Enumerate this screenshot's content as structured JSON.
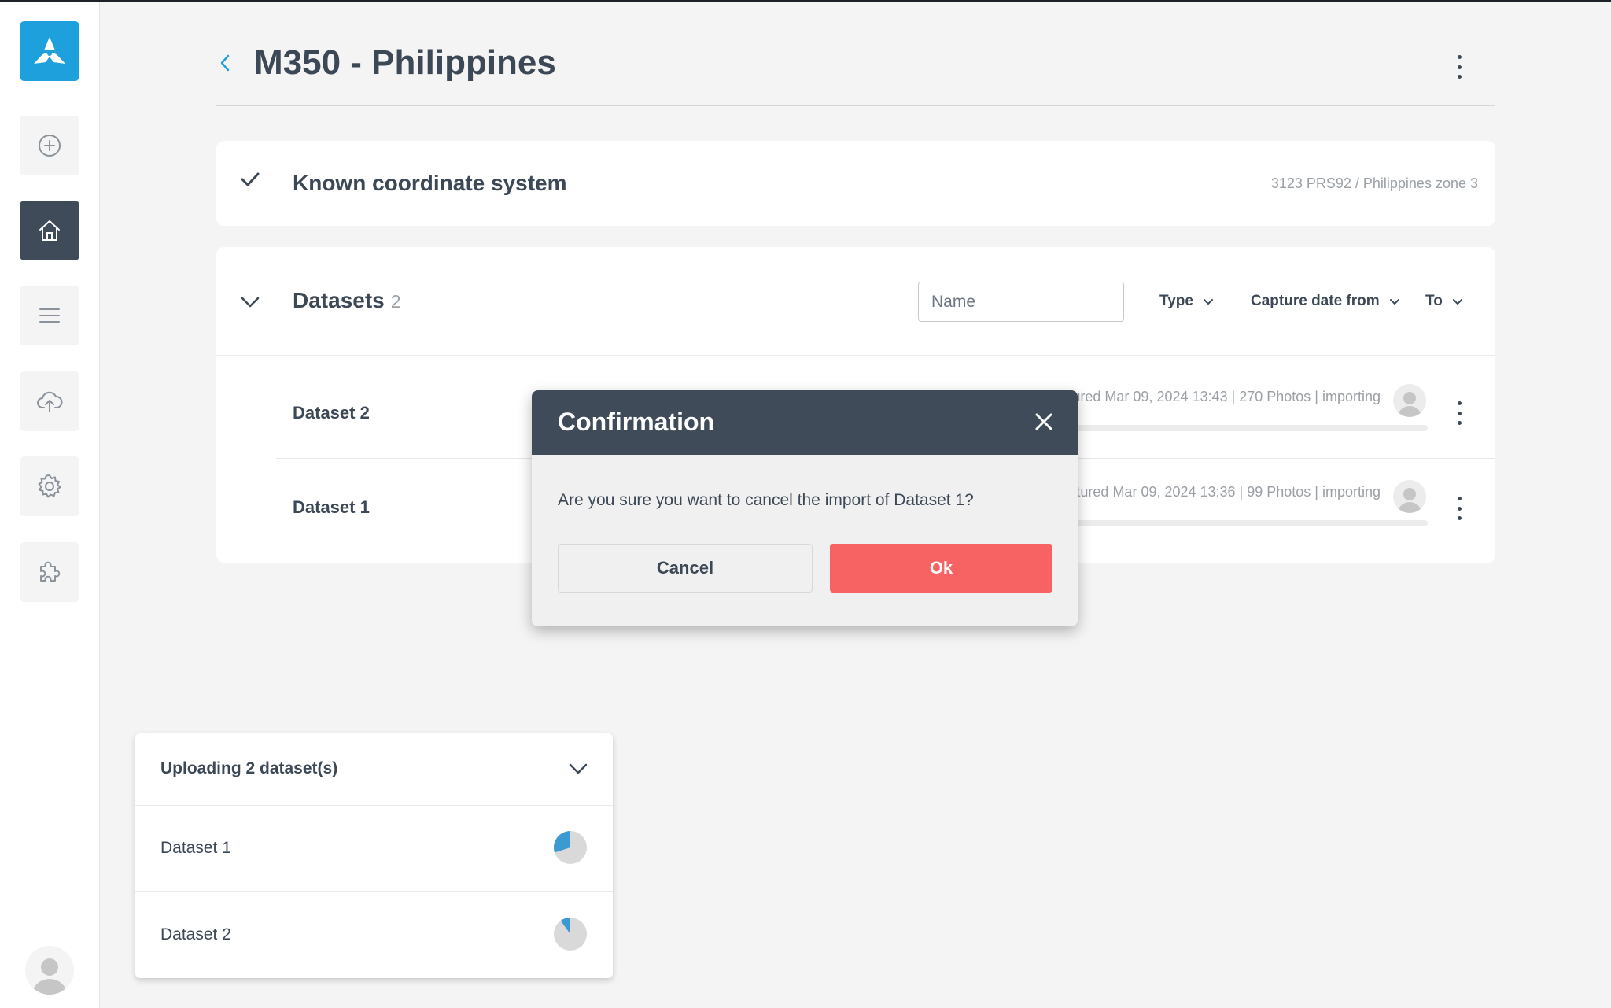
{
  "header": {
    "back_label": "",
    "title": "M350 - Philippines"
  },
  "sidebar": {
    "items": [
      {
        "name": "plus-circle-icon"
      },
      {
        "name": "home-icon",
        "active": true
      },
      {
        "name": "menu-icon"
      },
      {
        "name": "cloud-upload-icon"
      },
      {
        "name": "gear-icon"
      },
      {
        "name": "puzzle-icon"
      }
    ]
  },
  "coordinate_card": {
    "title": "Known coordinate system",
    "value": "3123 PRS92 / Philippines zone 3"
  },
  "datasets_card": {
    "title": "Datasets",
    "count": "2",
    "name_placeholder": "Name",
    "filters": {
      "type": "Type",
      "capture_from": "Capture date from",
      "to": "To"
    },
    "rows": [
      {
        "name": "Dataset 2",
        "meta": "Captured Mar 09, 2024 13:43 | 270 Photos | importing",
        "progress": 0
      },
      {
        "name": "Dataset 1",
        "meta": "Captured Mar 09, 2024 13:36 | 99 Photos | importing",
        "progress": 0
      }
    ]
  },
  "upload_panel": {
    "title": "Uploading 2 dataset(s)",
    "items": [
      {
        "name": "Dataset 1",
        "progress_fraction": 0.3
      },
      {
        "name": "Dataset 2",
        "progress_fraction": 0.1
      }
    ]
  },
  "modal": {
    "title": "Confirmation",
    "message": "Are you sure you want to cancel the import of Dataset 1?",
    "cancel_label": "Cancel",
    "ok_label": "Ok"
  },
  "colors": {
    "brand": "#1ea0dc",
    "sidebar_active": "#3f4b59",
    "danger": "#f76262",
    "progress": "#3c9ad2"
  }
}
